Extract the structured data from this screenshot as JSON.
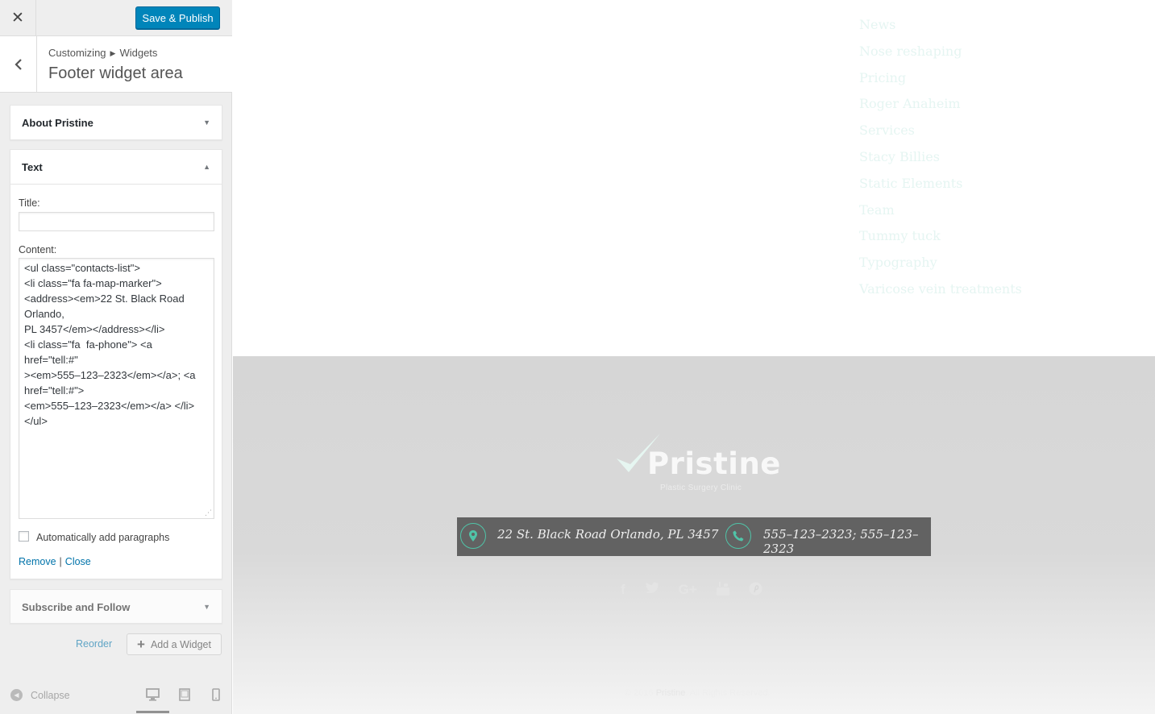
{
  "topbar": {
    "close_icon": "close-icon",
    "publish_label": "Save & Publish"
  },
  "panel": {
    "breadcrumb_parent": "Customizing",
    "breadcrumb_current": "Widgets",
    "title": "Footer widget area"
  },
  "widgets": {
    "about": {
      "title": "About Pristine"
    },
    "text": {
      "title": "Text",
      "title_label": "Title:",
      "title_value": "",
      "content_label": "Content:",
      "content_lines": [
        "<ul class=\"contacts-list\">",
        "<li class=\"fa fa-map-marker\">",
        "<address><em>22 St. Black Road",
        "Orlando,",
        "PL 3457</em></address></li>",
        "<li class=\"fa  fa-phone\"> <a",
        "href=\"tell:#\"",
        "><em>555–123–2323</em></a>; <a",
        "href=\"tell:#\">",
        "<em>555–123–2323</em></a> </li>",
        "</ul>"
      ],
      "autop_label": "Automatically add paragraphs",
      "autop_checked": false,
      "remove_label": "Remove",
      "close_label": "Close"
    },
    "subscribe": {
      "title": "Subscribe and Follow"
    }
  },
  "panel_actions": {
    "reorder_label": "Reorder",
    "add_widget_label": "Add a Widget"
  },
  "bottom": {
    "collapse_label": "Collapse",
    "active_device": "desktop"
  },
  "preview": {
    "page_links": [
      "News",
      "Nose reshaping",
      "Pricing",
      "Roger Anaheim",
      "Services",
      "Stacy Billies",
      "Static Elements",
      "Team",
      "Tummy tuck",
      "Typography",
      "Varicose vein treatments"
    ],
    "logo_text": "Pristine",
    "logo_tagline": "Plastic Surgery Clinic",
    "address": "22 St. Black Road Orlando, PL 3457",
    "phones": "555–123–2323; 555–123–2323",
    "social_icons": [
      "facebook-icon",
      "twitter-icon",
      "google-plus-icon",
      "youtube-icon",
      "pinterest-icon"
    ],
    "copyright_prefix": "© 2016",
    "copyright_brand": "Pristine",
    "copyright_suffix": ". All Rights Reserved.",
    "accent_color": "#50c4a8"
  }
}
